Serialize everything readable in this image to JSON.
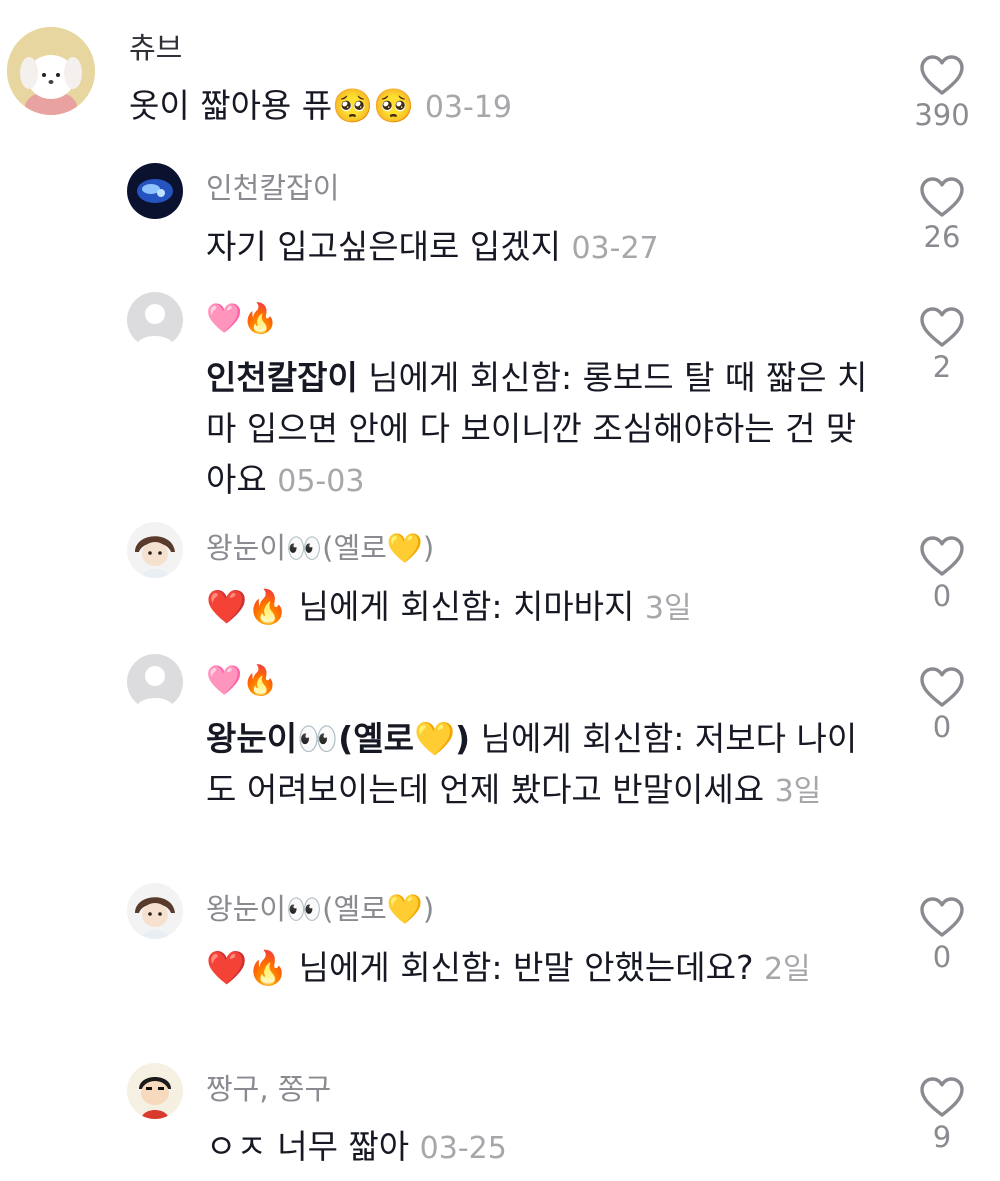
{
  "comments": [
    {
      "username": "츄브",
      "text": "옷이 짧아용 퓨🥺🥺",
      "date": "03-19",
      "likes": "390",
      "avatar": "puppy-avatar"
    },
    {
      "username": "인천칼잡이",
      "text": "자기 입고싶은대로 입겠지",
      "date": "03-27",
      "likes": "26",
      "avatar": "blue-hand-avatar"
    },
    {
      "username": "🩷🔥",
      "mention": "인천칼잡이",
      "reply_label": " 님에게 회신함: ",
      "text": "롱보드 탈 때 짧은 치마 입으면 안에 다 보이니깐 조심해야하는 건 맞아요",
      "date": "05-03",
      "likes": "2",
      "avatar": "default-avatar"
    },
    {
      "username": "왕눈이👀(옐로💛)",
      "mention": "❤️🔥",
      "reply_label": " 님에게 회신함: ",
      "text": "치마바지",
      "date": "3일",
      "likes": "0",
      "avatar": "anime-girl-avatar"
    },
    {
      "username": "🩷🔥",
      "mention": "왕눈이👀(옐로💛)",
      "reply_label": " 님에게 회신함: ",
      "text": "저보다 나이도 어려보이는데 언제 봤다고 반말이세요",
      "date": "3일",
      "likes": "0",
      "avatar": "default-avatar"
    },
    {
      "username": "왕눈이👀(옐로💛)",
      "mention": "❤️🔥",
      "reply_label": " 님에게 회신함: ",
      "text": "반말 안했는데요?",
      "date": "2일",
      "likes": "0",
      "avatar": "anime-girl-avatar"
    },
    {
      "username": "짱구, 쫑구",
      "text": "ㅇㅈ 너무 짧아",
      "date": "03-25",
      "likes": "9",
      "avatar": "shinchan-avatar"
    }
  ],
  "icons": {
    "like": "heart-outline-icon"
  },
  "colors": {
    "username": "#8a8b91",
    "date": "#a6a7ab",
    "text": "#161823",
    "icon": "#8a8b91"
  }
}
